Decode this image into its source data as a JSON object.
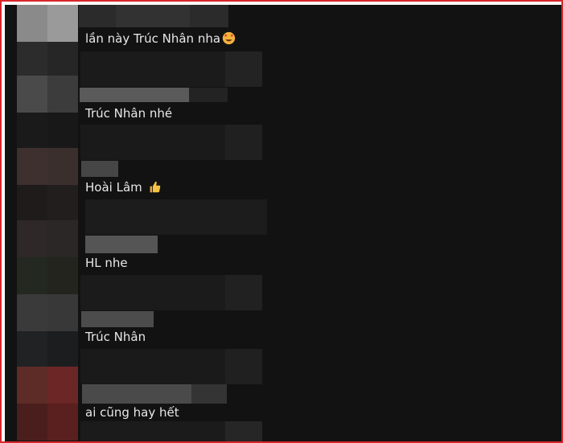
{
  "comments": [
    {
      "text": "lần này Trúc Nhân nha",
      "emoji_icon": "star-struck-face-icon"
    },
    {
      "text": "Trúc Nhân nhé"
    },
    {
      "text": "Hoài Lâm ",
      "emoji_icon": "thumbs-up-icon"
    },
    {
      "text": "HL nhe"
    },
    {
      "text": "Trúc Nhân"
    },
    {
      "text": "ai cũng hay hết"
    }
  ],
  "colors": {
    "background": "#121212",
    "text": "#e8e8e8",
    "frame_border": "#d8262c",
    "censor_block": "#1b1b1b",
    "censor_name": "#595959"
  }
}
